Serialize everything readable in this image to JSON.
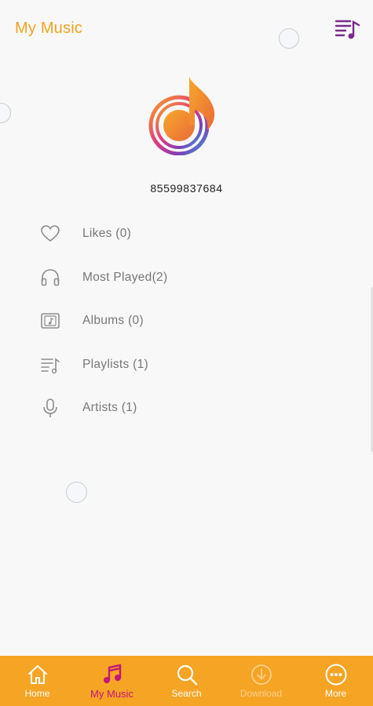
{
  "header": {
    "title": "My Music",
    "queue_icon": "playlist-music-icon"
  },
  "profile": {
    "logo_icon": "music-note-logo",
    "phone": "85599837684"
  },
  "menu": [
    {
      "label": "Likes (0)",
      "icon": "heart-icon"
    },
    {
      "label": "Most Played(2)",
      "icon": "headphones-icon"
    },
    {
      "label": "Albums (0)",
      "icon": "album-icon"
    },
    {
      "label": "Playlists (1)",
      "icon": "playlist-icon"
    },
    {
      "label": "Artists (1)",
      "icon": "microphone-icon"
    }
  ],
  "bottom_nav": [
    {
      "label": "Home",
      "icon": "home-icon"
    },
    {
      "label": "My Music",
      "icon": "music-note-icon",
      "active": true
    },
    {
      "label": "Search",
      "icon": "search-icon"
    },
    {
      "label": "Download",
      "icon": "download-icon",
      "disabled": true
    },
    {
      "label": "More",
      "icon": "more-icon"
    }
  ],
  "colors": {
    "accent": "#f6a424",
    "title": "#f0a320",
    "active_tab": "#c2167a",
    "purple": "#7a2a8c"
  }
}
